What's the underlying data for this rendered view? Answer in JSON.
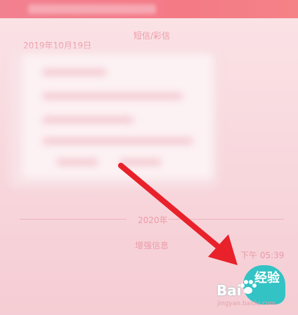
{
  "header": {
    "sms_label": "短信/彩信"
  },
  "messages": {
    "date": "2019年10月19日",
    "year": "2020年",
    "enhanced_label": "增强信息",
    "time": "下午 05:39"
  },
  "watermark": {
    "brand_text": "Bai",
    "brand_cn": "经验",
    "url": "jingyan.baidu.com",
    "teal_color": "#33c3c4"
  },
  "colors": {
    "topbar": "#f47a86",
    "arrow": "#e8212a",
    "label_text": "#ec9aa8"
  }
}
